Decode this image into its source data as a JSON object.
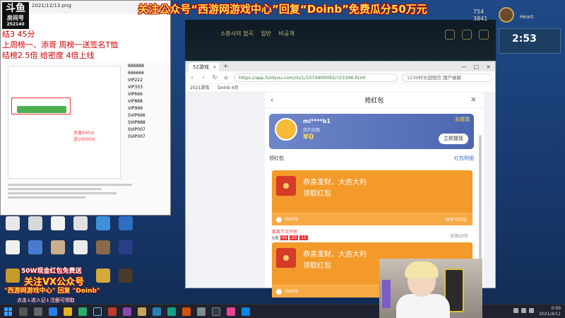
{
  "banner": {
    "text": "关注公众号“西游网游戏中心”回复“Doinb”免费瓜分50万元"
  },
  "image_viewer": {
    "title": "2021/12/13.png",
    "logo_top": "斗鱼",
    "logo_bottom": "房间号",
    "logo_num": "252140",
    "red_note": [
      "结3 45分",
      "上周榜一、添哥 周榜一送签名T恤",
      "结榜2.5倍 给密度 4倍上线"
    ],
    "codes": [
      "888888",
      "666666",
      "VIP222",
      "VIP333",
      "VIP666",
      "VIP888",
      "VIP999",
      "SVIP666",
      "SVIP888",
      "SVIP007",
      "SVIP007"
    ],
    "highlight_text": "充值500元",
    "highlight_text2": "送10000元"
  },
  "game": {
    "nav": [
      "소환사의 협곡",
      "일반",
      "비공개"
    ],
    "currency_a": "754",
    "currency_b": "3841",
    "profile_name": "Heart",
    "clock": "2:53"
  },
  "browser": {
    "tab_label": "52游戏",
    "url": "https://app.52dyou.com/m/1/1074400092/?23306.html",
    "search_placeholder": "1230时长超短信 国产破解",
    "bookmarks": [
      "2021游戏",
      "Doinb 4月"
    ],
    "page": {
      "title": "抢红包",
      "user_name": "mi****b1",
      "user_sub": "我的余额",
      "balance": "¥0",
      "top_link": "去提现",
      "withdraw_btn": "立即提现",
      "section_left": "领红包",
      "section_right": "红包明细",
      "packets": [
        {
          "line1": "恭喜发财，大吉大利",
          "line2": "领取红包",
          "user": "doinb",
          "detail": "拼手气红包"
        },
        {
          "line1": "恭喜发财，大吉大利",
          "line2": "领取红包",
          "user": "doinb",
          "detail": ""
        }
      ],
      "timer_label": "距离下次开抢",
      "timer_prefix": "0天",
      "timer_h": "00",
      "timer_m": "23",
      "timer_s": "11",
      "timer_right": "共领20包"
    }
  },
  "promo": {
    "line1": "50W现金红包免费送",
    "line2": "关注VX公众号",
    "line3": "\"西游网游戏中心\"  回复 \"Doinb\"",
    "line4": "点击↓进入记↓注册可领取"
  },
  "taskbar": {
    "time": "0:00",
    "date": "2021/4/11"
  },
  "colors": {
    "packet_orange": "#f39a2a",
    "card_blue": "#5a72bd",
    "banner_yellow": "#ffe14d"
  }
}
